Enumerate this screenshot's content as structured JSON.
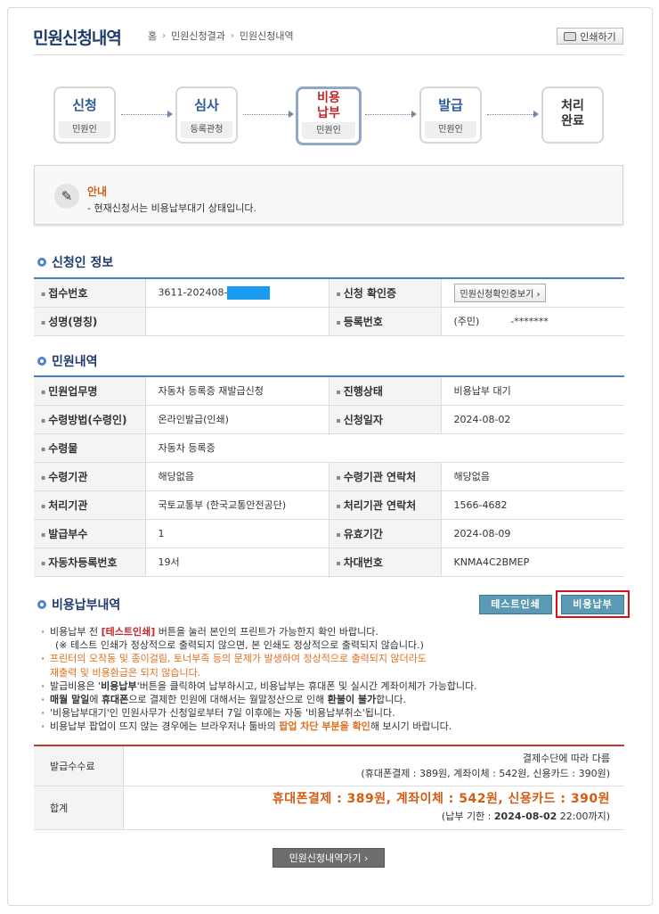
{
  "page_title": "민원신청내역",
  "breadcrumb": [
    "홈",
    "민원신청결과",
    "민원신청내역"
  ],
  "print_label": "인쇄하기",
  "steps": [
    {
      "label": "신청",
      "sub": "민원인"
    },
    {
      "label": "심사",
      "sub": "등록관청"
    },
    {
      "label": "비용\n납부",
      "sub": "민원인"
    },
    {
      "label": "발급",
      "sub": "민원인"
    },
    {
      "label": "처리\n완료",
      "sub": ""
    }
  ],
  "notice": {
    "title": "안내",
    "text": "- 현재신청서는 비용납부대기 상태입니다."
  },
  "applicant": {
    "heading": "신청인 정보",
    "rows": [
      {
        "k1": "접수번호",
        "v1": "3611-202408-",
        "k2": "신청 확인증",
        "v2": "민원신청확인증보기 ›"
      },
      {
        "k1": "성명(명칭)",
        "v1": "",
        "k2": "등록번호",
        "v2": "(주민)          -*******"
      }
    ]
  },
  "civil": {
    "heading": "민원내역",
    "rows": [
      {
        "k1": "민원업무명",
        "v1": "자동차 등록증 재발급신청",
        "k2": "진행상태",
        "v2": "비용납부 대기"
      },
      {
        "k1": "수령방법(수령인)",
        "v1": "온라인발급(인쇄)",
        "k2": "신청일자",
        "v2": "2024-08-02"
      },
      {
        "k1": "수령물",
        "v1": "자동차 등록증"
      },
      {
        "k1": "수령기관",
        "v1": "해당없음",
        "k2": "수령기관 연락처",
        "v2": "해당없음"
      },
      {
        "k1": "처리기관",
        "v1": "국토교통부 (한국교통안전공단)",
        "k2": "처리기관 연락처",
        "v2": "1566-4682"
      },
      {
        "k1": "발급부수",
        "v1": "1",
        "k2": "유효기간",
        "v2": "2024-08-09"
      },
      {
        "k1": "자동차등록번호",
        "v1": "19서",
        "k2": "차대번호",
        "v2": "KNMA4C2BMEP"
      }
    ]
  },
  "fee_section": {
    "heading": "비용납부내역",
    "test_print": "테스트인쇄",
    "pay": "비용납부",
    "lines": [
      {
        "t": "비용납부 전 ",
        "s1": "[테스트인쇄]",
        "t2": " 버튼을 눌러 본인의 프린트가 가능한지 확인 바랍니다."
      },
      {
        "t": "(※ 테스트 인쇄가 정상적으로 출력되지 않으면, 본 인쇄도 정상적으로 출력되지 않습니다.)"
      },
      {
        "t": "프린터의 오작동 및 종이걸림, 토너부족 등의 문제가 발생하여 정상적으로 출력되지 않더라도"
      },
      {
        "t": "재출력 및 비용환급은 되지 않습니다."
      },
      {
        "t": "발급비용은 '",
        "s1": "비용납부",
        "t2": "'버튼을 클릭하여 납부하시고, 비용납부는 휴대폰 및 실시간 계좌이체가 가능합니다."
      },
      {
        "s0": "매월 말일",
        "t": "에 ",
        "s1": "휴대폰",
        "t2": "으로 결제한 민원에 대해서는 월말정산으로 인해 ",
        "s2": "환불이 불가",
        "t3": "합니다."
      },
      {
        "t": "'비용납부대기'인 민원사무가 신청일로부터 7일 이후에는 자동 '비용납부취소'됩니다."
      },
      {
        "t": "비용납부 팝업이 뜨지 않는 경우에는 브라우저나 툴바의 ",
        "s1": "팝업 차단 부분을 확인",
        "t2": "해 보시기 바랍니다."
      }
    ],
    "fee_label": "발급수수료",
    "fee_line1": "결제수단에 따라 다름",
    "fee_line2": "(휴대폰결제 : 389원, 계좌이체 : 542원, 신용카드 : 390원)",
    "total_label": "합계",
    "total_line": "휴대폰결제 : 389원, 계좌이체 : 542원, 신용카드 : 390원",
    "deadline_prefix": "(납부 기한 : ",
    "deadline_date": "2024-08-02",
    "deadline_suffix": " 22:00까지)"
  },
  "bottom_button": "민원신청내역가기 ›"
}
